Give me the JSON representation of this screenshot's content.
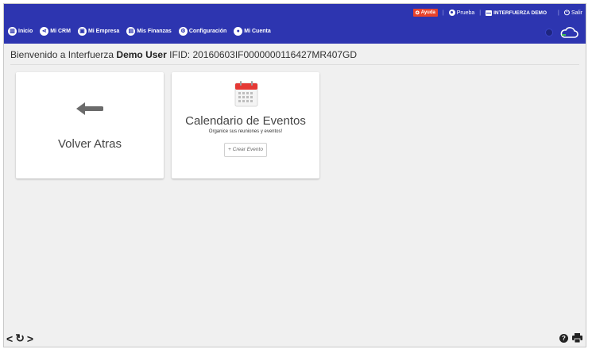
{
  "header": {
    "help_label": "Ayuda",
    "user_label": "Prueba",
    "company_label": "INTERFUERZA DEMO",
    "logout_label": "Salir",
    "sep": "|"
  },
  "menu": [
    {
      "label": "Inicio",
      "icon": "grid-icon"
    },
    {
      "label": "Mi CRM",
      "icon": "share-icon"
    },
    {
      "label": "Mi Empresa",
      "icon": "briefcase-icon"
    },
    {
      "label": "Mis Finanzas",
      "icon": "wallet-icon"
    },
    {
      "label": "Configuración",
      "icon": "gear-icon"
    },
    {
      "label": "Mi Cuenta",
      "icon": "user-icon"
    }
  ],
  "welcome": {
    "prefix": "Bienvenido a Interfuerza ",
    "user": "Demo User",
    "suffix": " IFID: 20160603IF0000000116427MR407GD"
  },
  "cards": {
    "back_title": "Volver Atras",
    "calendar_title": "Calendario de Eventos",
    "calendar_sub": "Organice sus reuniones y eventos!",
    "create_label": "+ Crear Evento"
  },
  "colors": {
    "header_bg": "#2d35b0",
    "help_bg": "#e8432c",
    "page_bg": "#f0f0f0"
  }
}
